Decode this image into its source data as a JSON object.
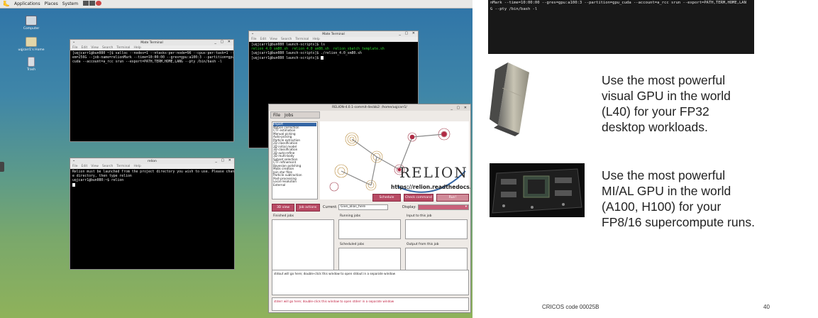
{
  "topbar": {
    "applications": "Applications",
    "places": "Places",
    "system": "System"
  },
  "desktop_icons": [
    {
      "label": "Computer",
      "icon": "computer-icon"
    },
    {
      "label": "uqjcarr1's Home",
      "icon": "home-folder-icon"
    },
    {
      "label": "Trash",
      "icon": "trash-icon"
    }
  ],
  "mate_terminal_1": {
    "title": "Mate Terminal",
    "menu": [
      "File",
      "Edit",
      "View",
      "Search",
      "Terminal",
      "Help"
    ],
    "lines": [
      "[uqjcarr1@bun080 ~]$ salloc --nodes=1 --ntasks-per-node=96 --cpus-per-task=1 --m",
      "em=256G --job-name=relionMark --time=10:00:00 --gres=gpu:a100:3 --partition=gpu_",
      "cuda --account=a_rcc srun --export=PATH,TERM,HOME,LANG --pty /bin/bash -l"
    ]
  },
  "mate_terminal_2": {
    "title": "Mate Terminal",
    "menu": [
      "File",
      "Edit",
      "View",
      "Search",
      "Terminal",
      "Help"
    ],
    "lines": [
      "[uqjcarr1@bun080 launch-scripts]$ ls",
      "relion_4.0_sm80.sh  relion_4.0_sm86.sh  relion_sbatch_template.sh",
      "[uqjcarr1@bun080 launch-scripts]$ ./relion_4.0_sm80.sh",
      "[uqjcarr1@bun080 launch-scripts]$ "
    ]
  },
  "relion_terminal": {
    "title": "relion",
    "menu": [
      "File",
      "Edit",
      "View",
      "Search",
      "Terminal",
      "Help"
    ],
    "lines": [
      "Relion must be launched from the project directory you wish to use. Please chang",
      "e directory, then type relion",
      "uqjcarr1@bun080:~$ relion"
    ]
  },
  "relion_gui": {
    "title": "RELION-4.0.1-commit-4ecbb2: /home/uqjcarr1/",
    "menu": [
      "File",
      "Jobs"
    ],
    "jobs": [
      "Import",
      "Motion correction",
      "CTF estimation",
      "Manual picking",
      "Auto-picking",
      "Particle extraction",
      "2D classification",
      "3D initial model",
      "3D classification",
      "3D auto-refine",
      "3D multi-body",
      "Subset selection",
      "CTF refinement",
      "Bayesian polishing",
      "Mask creation",
      "Join star files",
      "Particle subtraction",
      "Post-processing",
      "Local resolution",
      "External"
    ],
    "logo_text": "RELION",
    "logo_url": "https://relion.readthedocs.io",
    "btn_schedule": "Schedule",
    "btn_check_command": "Check command",
    "btn_run": "Run!",
    "btn_3d_view": "3D view",
    "btn_job_actions": "Job actions",
    "current_label": "Current:",
    "current_value": "Give_alias_here",
    "display_label": "Display:",
    "finished_jobs": "Finished jobs",
    "running_jobs": "Running jobs",
    "scheduled_jobs": "Scheduled jobs",
    "input_to_job": "Input to this job",
    "output_from_job": "Output from this job",
    "stdout_hint": "stdout will go here; double-click this window to open stdout in a separate window",
    "stderr_hint": "stderr will go here; double-click this window to open stderr in a separate window"
  },
  "right_terminal": {
    "lines": [
      "nMark --time=10:00:00 --gres=gpu:a100:3 --partition=gpu_cuda --account=a_rcc srun --export=PATH,TERM,HOME,LAN",
      "G --pty /bin/bash -l"
    ]
  },
  "slide": {
    "blurb_1": [
      "Use the most powerful",
      "visual GPU in the world",
      "(L40) for your FP32",
      "desktop workloads."
    ],
    "blurb_2": [
      "Use the most powerful",
      "MI/AL GPU in the world",
      "(A100, H100) for your",
      "FP8/16 supercompute runs."
    ],
    "cricos": "CRICOS code 00025B",
    "page_number": "40"
  }
}
